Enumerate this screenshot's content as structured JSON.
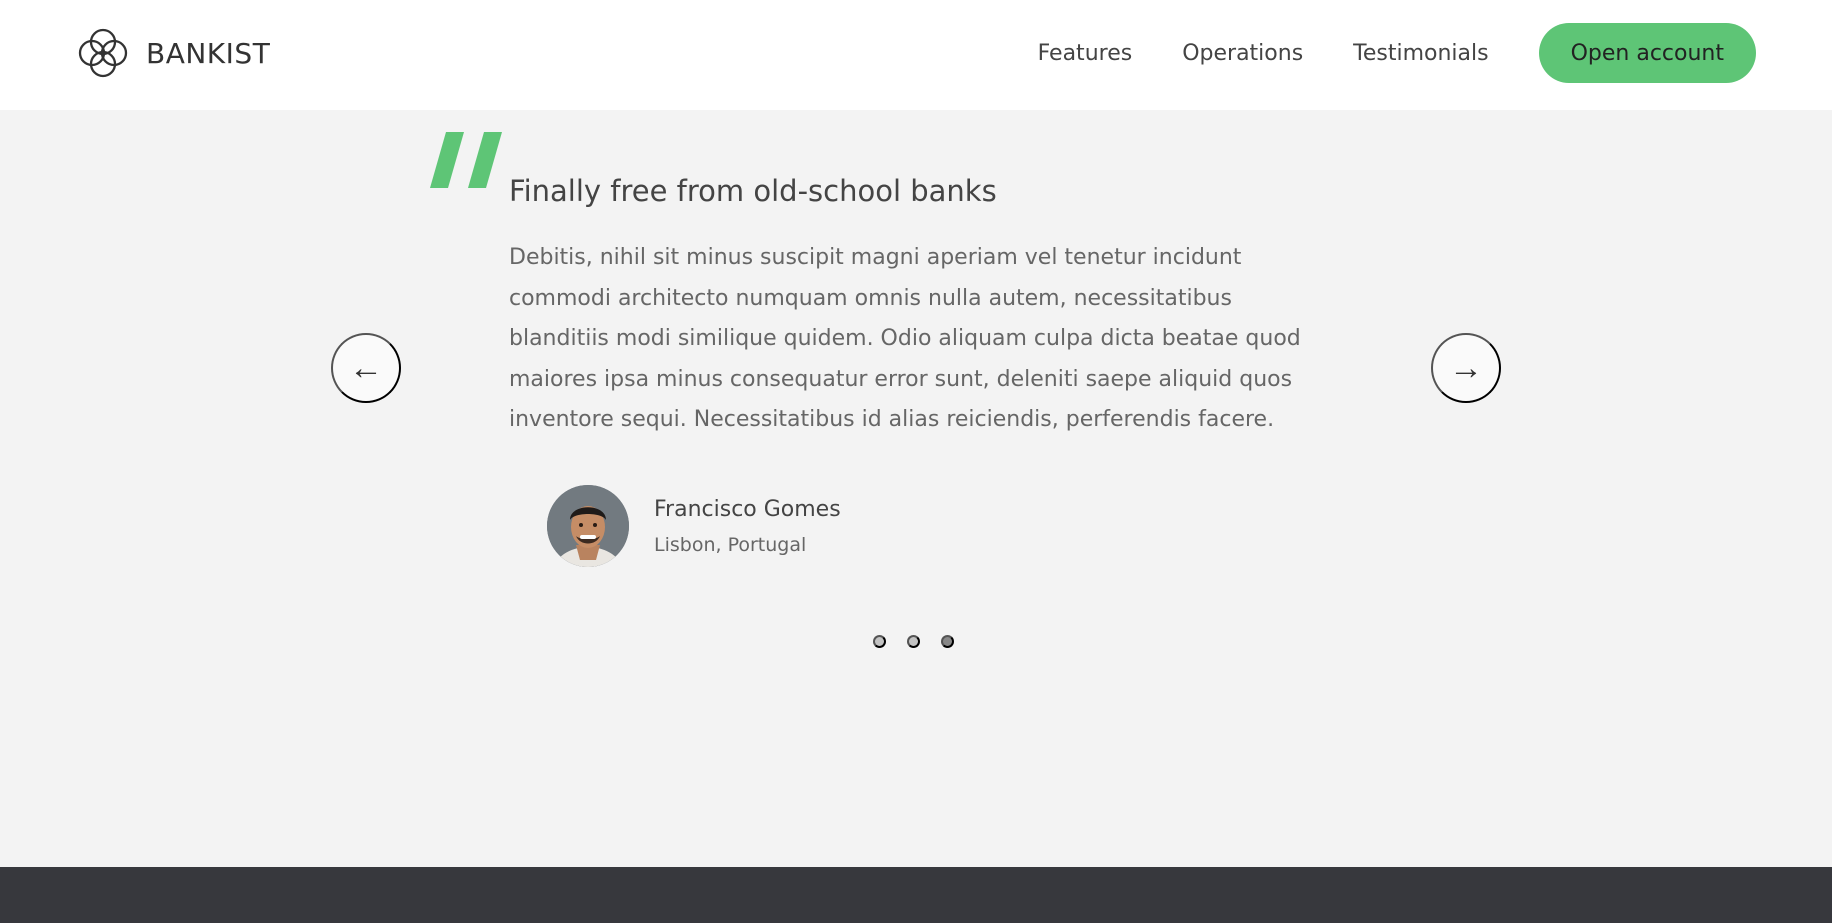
{
  "header": {
    "brand_name": "BANKIST",
    "nav_links": [
      "Features",
      "Operations",
      "Testimonials"
    ],
    "cta_label": "Open account"
  },
  "testimonial": {
    "title": "Finally free from old-school banks",
    "text": "Debitis, nihil sit minus suscipit magni aperiam vel tenetur incidunt commodi architecto numquam omnis nulla autem, necessitatibus blanditiis modi similique quidem. Odio aliquam culpa dicta beatae quod maiores ipsa minus consequatur error sunt, deleniti saepe aliquid quos inventore sequi. Necessitatibus id alias reiciendis, perferendis facere.",
    "author_name": "Francisco Gomes",
    "author_location": "Lisbon, Portugal"
  },
  "slider": {
    "prev_icon": "←",
    "next_icon": "→",
    "dot_count": 3,
    "active_dot": 3
  },
  "colors": {
    "accent": "#5ec576",
    "section_bg": "#f3f3f3",
    "footer_bg": "#37383d"
  }
}
